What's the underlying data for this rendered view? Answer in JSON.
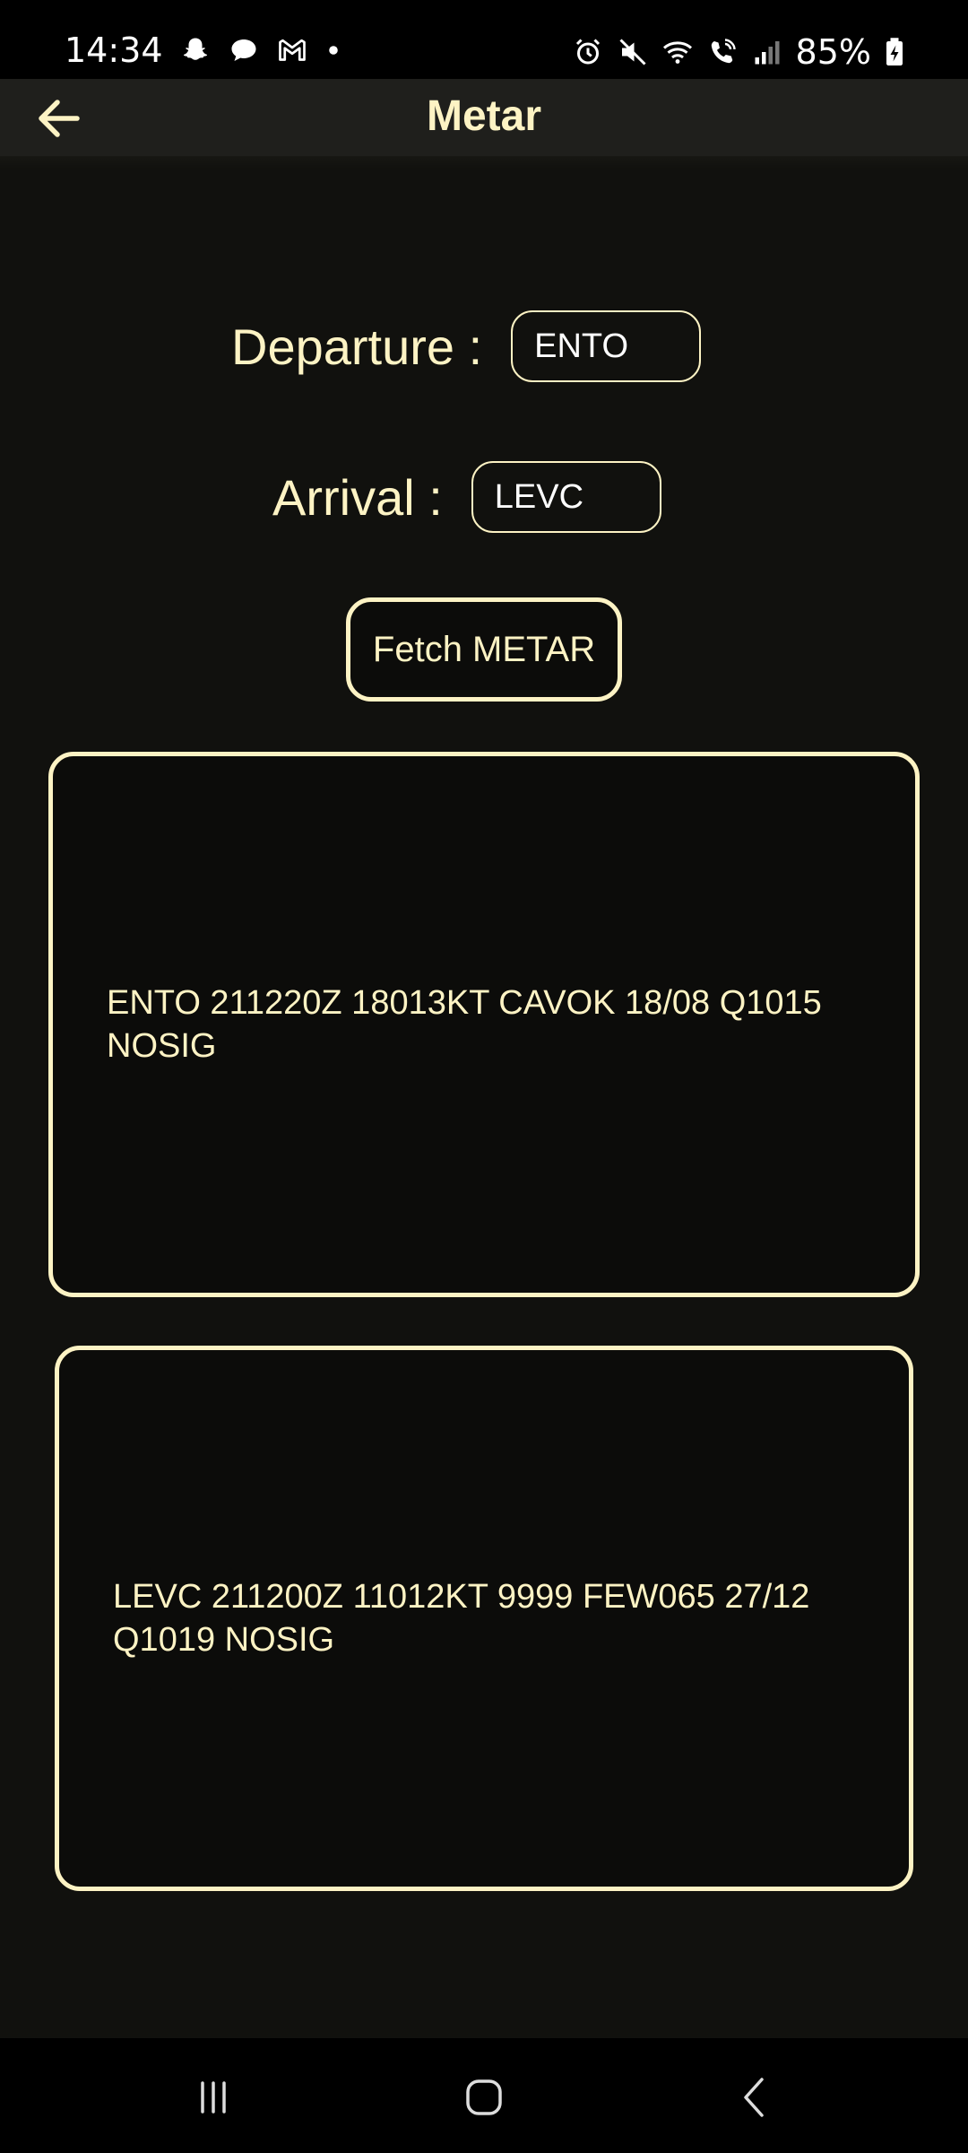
{
  "status_bar": {
    "time": "14:34",
    "battery": "85%",
    "icons_left": [
      "snapchat-icon",
      "chat-bubble-icon",
      "gmail-icon",
      "dot-icon"
    ],
    "icons_right": [
      "alarm-icon",
      "mute-icon",
      "wifi-icon",
      "wifi-calling-icon",
      "signal-icon",
      "battery-charging-icon"
    ]
  },
  "app_bar": {
    "title": "Metar",
    "back_icon": "arrow-left-icon"
  },
  "form": {
    "departure_label": "Departure :",
    "departure_value": "ENTO",
    "arrival_label": "Arrival :",
    "arrival_value": "LEVC",
    "fetch_label": "Fetch METAR"
  },
  "results": {
    "departure_metar": "ENTO 211220Z 18013KT CAVOK 18/08 Q1015 NOSIG",
    "arrival_metar": "LEVC 211200Z 11012KT 9999 FEW065 27/12 Q1019 NOSIG"
  },
  "nav_bar": {
    "recents_icon": "recents-icon",
    "home_icon": "home-icon",
    "back_icon": "back-chevron-icon"
  },
  "colors": {
    "accent": "#fdf3c4",
    "background": "#11110e",
    "app_bar": "#1f1f1c"
  }
}
